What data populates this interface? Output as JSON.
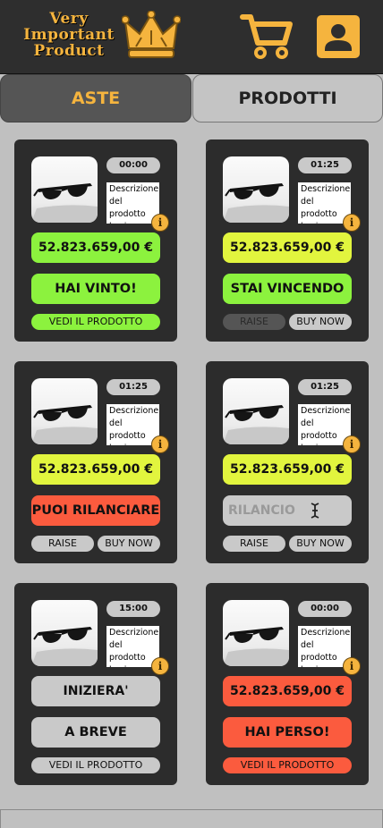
{
  "logo": {
    "line1": "Very",
    "line2": "Important",
    "line3": "Product"
  },
  "tabs": {
    "aste": "ASTE",
    "prodotti": "PRODOTTI"
  },
  "colors": {
    "accent": "#f5b43e",
    "green": "#8cf23e",
    "yellow": "#e2f53e",
    "red": "#fb5b3e",
    "card": "#2c2c2c"
  },
  "cards": [
    {
      "timer": "00:00",
      "desc": "Descrizione del prodotto basica",
      "info": "i",
      "price": "52.823.659,00 €",
      "status": "HAI VINTO!",
      "link": "VEDI IL PRODOTTO"
    },
    {
      "timer": "01:25",
      "desc": "Descrizione del prodotto basica",
      "info": "i",
      "price": "52.823.659,00 €",
      "status": "STAI VINCENDO",
      "raise": "RAISE",
      "buy": "BUY NOW"
    },
    {
      "timer": "01:25",
      "desc": "Descrizione del prodotto basica",
      "info": "i",
      "price": "52.823.659,00 €",
      "status": "PUOI RILANCIARE",
      "raise": "RAISE",
      "buy": "BUY NOW"
    },
    {
      "timer": "01:25",
      "desc": "Descrizione del prodotto basica",
      "info": "i",
      "price": "52.823.659,00 €",
      "placeholder": "RILANCIO",
      "raise": "RAISE",
      "buy": "BUY NOW"
    },
    {
      "timer": "15:00",
      "desc": "Descrizione del prodotto basica",
      "info": "i",
      "line1": "INIZIERA'",
      "line2": "A BREVE",
      "link": "VEDI IL PRODOTTO"
    },
    {
      "timer": "00:00",
      "desc": "Descrizione del prodotto basica",
      "info": "i",
      "price": "52.823.659,00 €",
      "status": "HAI PERSO!",
      "link": "VEDI IL PRODOTTO"
    }
  ]
}
